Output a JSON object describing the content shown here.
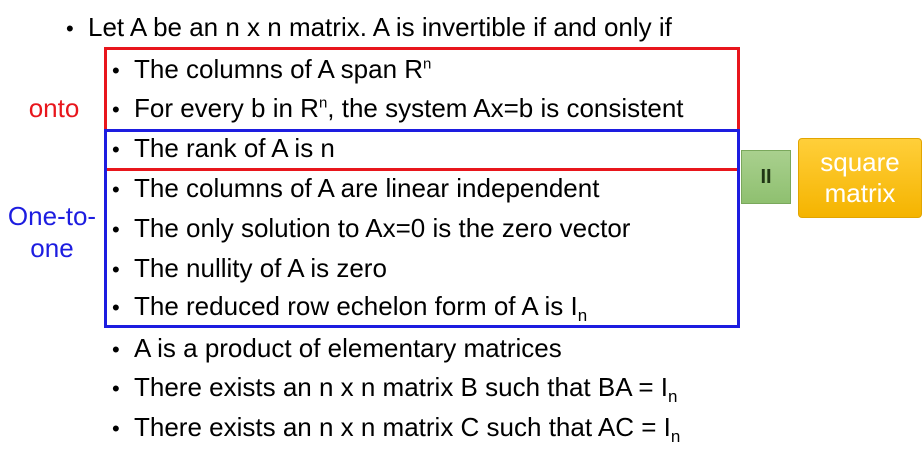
{
  "heading": "Let A be an n x n matrix. A is invertible if and only if",
  "bullet_glyph": "•",
  "items": [
    {
      "text": "The columns of A span R",
      "sup": "n",
      "tail": ""
    },
    {
      "text": "For every b in R",
      "sup": "n",
      "tail": ", the system Ax=b is consistent"
    },
    {
      "text": "The rank of A is n"
    },
    {
      "text": "The columns of A are linear independent"
    },
    {
      "text": "The only solution to Ax=0 is the zero vector"
    },
    {
      "text": "The nullity of A is zero"
    },
    {
      "text": "The reduced row echelon form of A is I",
      "sub": "n"
    },
    {
      "text": "A is a product of elementary matrices"
    },
    {
      "text": "There exists an n x n matrix B such that BA = I",
      "sub": "n"
    },
    {
      "text": "There exists an n x n matrix C such that AC = I",
      "sub": "n"
    }
  ],
  "labels": {
    "onto": "onto",
    "one_to_one_line1": "One-to-",
    "one_to_one_line2": "one"
  },
  "equals_symbol": "II",
  "square_matrix": {
    "line1": "square",
    "line2": "matrix"
  },
  "colors": {
    "onto_label": "#e8161c",
    "one_to_one_label": "#1d1de0",
    "red_box": "#e8161c",
    "blue_box": "#1d1de0",
    "equals_tile": "#a9d08e",
    "square_tile": "#ffc000"
  }
}
